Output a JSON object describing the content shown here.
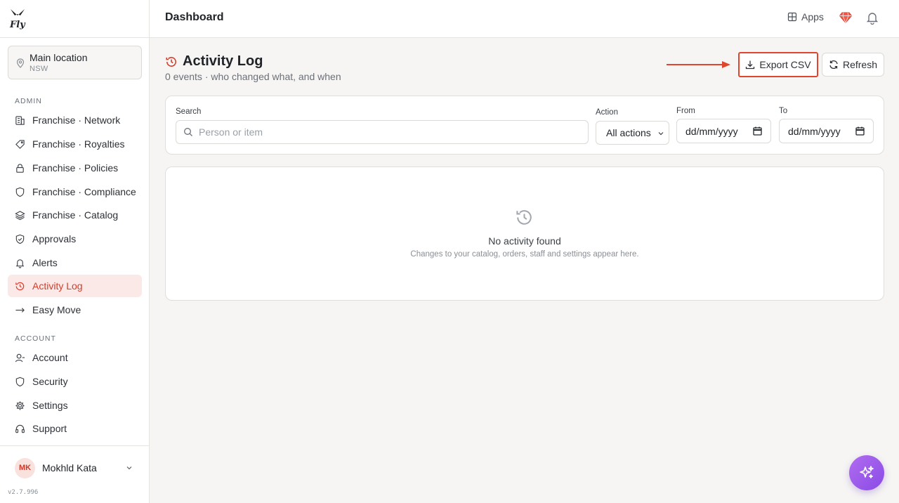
{
  "app": {
    "logo_text": "Fly",
    "version": "v2.7.996"
  },
  "location": {
    "name": "Main location",
    "region": "NSW"
  },
  "sidebar": {
    "admin_label": "ADMIN",
    "account_label": "ACCOUNT",
    "admin_items": [
      {
        "label": "Franchise · Network",
        "icon": "building-icon"
      },
      {
        "label": "Franchise · Royalties",
        "icon": "percent-icon"
      },
      {
        "label": "Franchise · Policies",
        "icon": "lock-icon"
      },
      {
        "label": "Franchise · Compliance",
        "icon": "shield-icon"
      },
      {
        "label": "Franchise · Catalog",
        "icon": "layers-icon"
      },
      {
        "label": "Approvals",
        "icon": "shield-check-icon"
      },
      {
        "label": "Alerts",
        "icon": "bell-icon"
      },
      {
        "label": "Activity Log",
        "icon": "history-icon",
        "active": true
      },
      {
        "label": "Easy Move",
        "icon": "arrow-right-icon"
      }
    ],
    "account_items": [
      {
        "label": "Account",
        "icon": "user-icon"
      },
      {
        "label": "Security",
        "icon": "shield-icon"
      },
      {
        "label": "Settings",
        "icon": "gear-icon"
      },
      {
        "label": "Support",
        "icon": "headset-icon"
      }
    ]
  },
  "user": {
    "initials": "MK",
    "name": "Mokhld Kata"
  },
  "topbar": {
    "title": "Dashboard",
    "apps_label": "Apps"
  },
  "page": {
    "title": "Activity Log",
    "subtitle": "0 events · who changed what, and when",
    "export_label": "Export CSV",
    "refresh_label": "Refresh"
  },
  "filters": {
    "search_label": "Search",
    "search_placeholder": "Person or item",
    "search_value": "",
    "action_label": "Action",
    "action_value": "All actions",
    "from_label": "From",
    "from_value": "dd/mm/yyyy",
    "to_label": "To",
    "to_value": "dd/mm/yyyy"
  },
  "empty": {
    "title": "No activity found",
    "subtitle": "Changes to your catalog, orders, staff and settings appear here."
  },
  "colors": {
    "accent": "#e0452f",
    "active_bg": "#fbe9e7",
    "active_text": "#d63c2b",
    "fab": "#9b5cf0"
  }
}
